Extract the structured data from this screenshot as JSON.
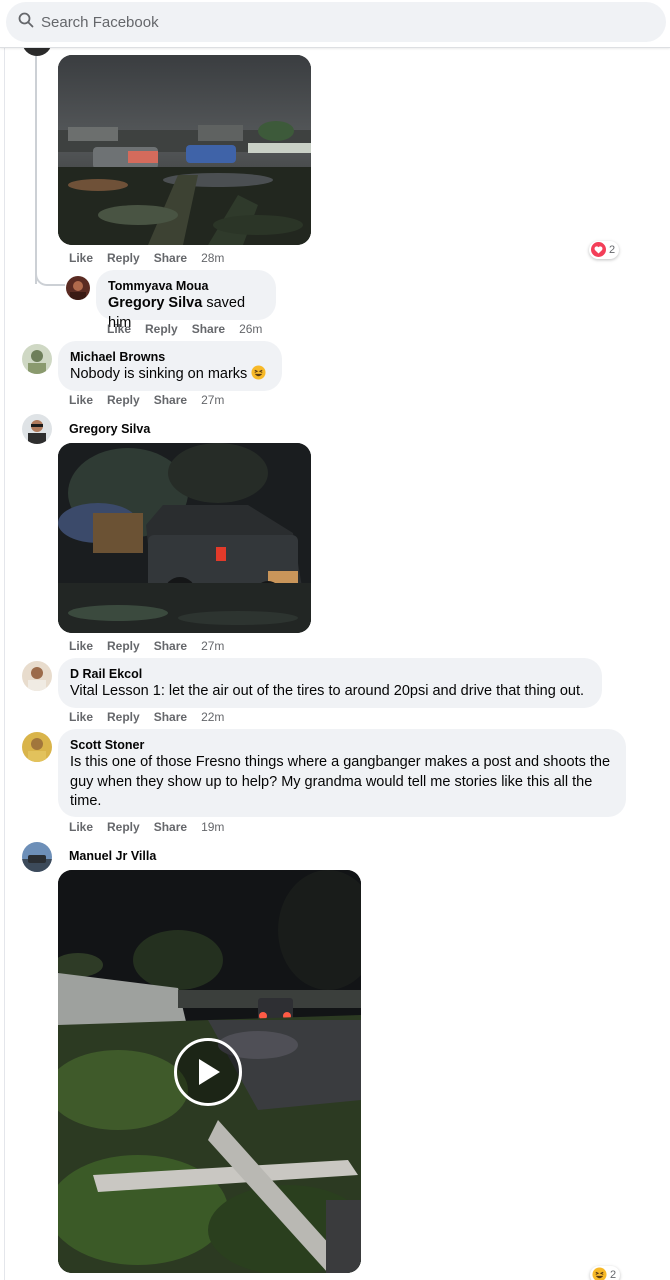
{
  "search": {
    "placeholder": "Search Facebook"
  },
  "actions": {
    "like": "Like",
    "reply": "Reply",
    "share": "Share"
  },
  "comments": [
    {
      "name": "",
      "time": "28m",
      "reaction_count": "2",
      "has_image": true
    },
    {
      "name": "Tommyava Moua",
      "mention": "Gregory Silva",
      "text": " saved him",
      "time": "26m"
    },
    {
      "name": "Michael Browns",
      "text": "Nobody is sinking on marks",
      "emoji": "grinning-squint-emoji",
      "time": "27m"
    },
    {
      "name": "Gregory Silva",
      "time": "27m",
      "has_image": true
    },
    {
      "name": "D Rail Ekcol",
      "text": "Vital Lesson 1: let the air out of the tires to around 20psi and drive that thing out.",
      "time": "22m"
    },
    {
      "name": "Scott Stoner",
      "text": "Is this one of those Fresno things where a gangbanger makes a post and shoots the guy when they show up to help? My grandma would tell me stories like this all the time.",
      "time": "19m"
    },
    {
      "name": "Manuel Jr Villa",
      "has_video": true,
      "reaction_count": "2"
    }
  ],
  "colors": {
    "bubble": "#f0f2f5",
    "meta_text": "#65676b",
    "love": "#f33e58",
    "haha": "#f7b928"
  }
}
